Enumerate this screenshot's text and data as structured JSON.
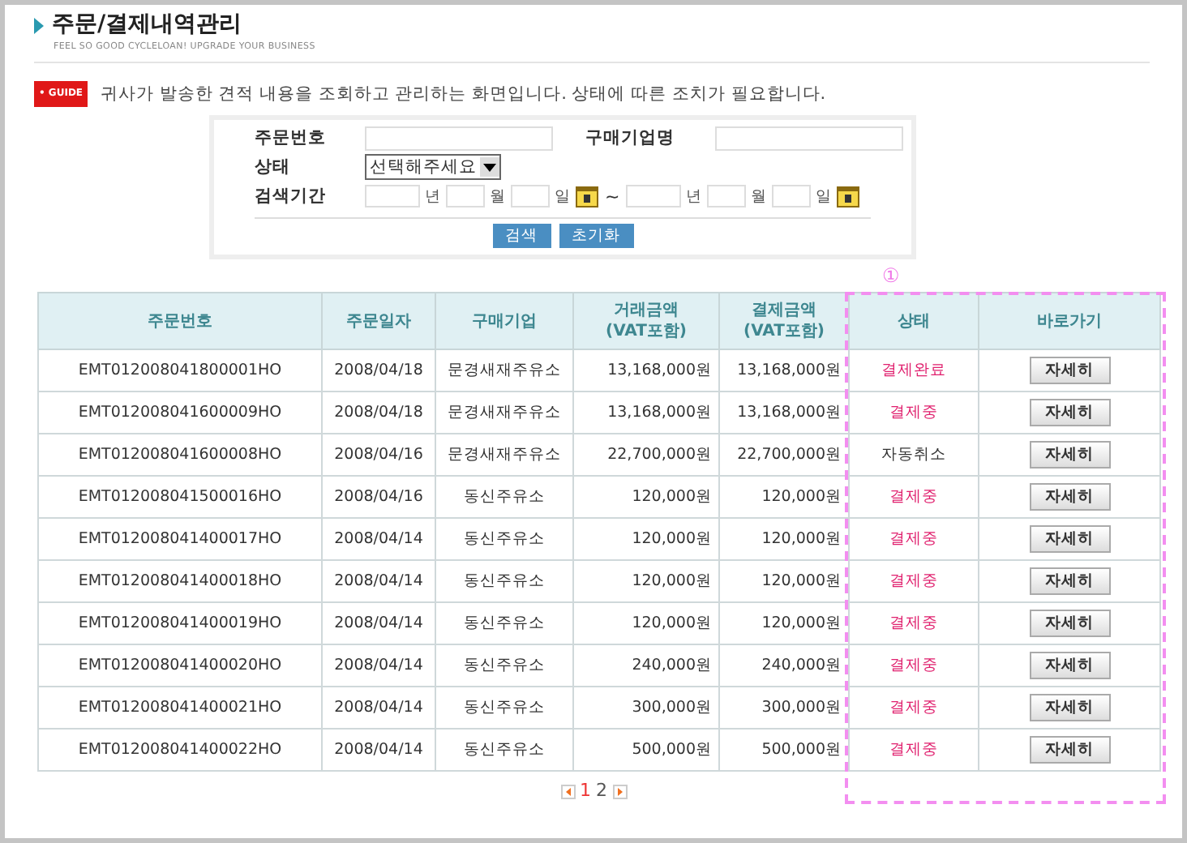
{
  "header": {
    "title": "주문/결제내역관리",
    "subtitle": "FEEL SO GOOD CYCLELOAN! UPGRADE YOUR BUSINESS"
  },
  "guide": {
    "badge": "• GUIDE",
    "text": "귀사가 발송한 견적 내용을 조회하고 관리하는 화면입니다. 상태에 따른 조치가 필요합니다."
  },
  "search": {
    "order_no_label": "주문번호",
    "buyer_label": "구매기업명",
    "status_label": "상태",
    "status_value": "선택해주세요",
    "period_label": "검색기간",
    "period_from_units": [
      "년",
      "월",
      "일"
    ],
    "period_sep": "~",
    "period_to_units": [
      "년",
      "월",
      "일"
    ],
    "buttons": [
      "검색",
      "초기화"
    ]
  },
  "annotation": {
    "marker": "①"
  },
  "table": {
    "columns": [
      "주문번호",
      "주문일자",
      "구매기업",
      "거래금액\n(VAT포함)",
      "결제금액\n(VAT포함)",
      "상태",
      "바로가기"
    ],
    "rows": [
      {
        "order_no": "EMT012008041800001HO",
        "date": "2008/04/18",
        "buyer": "문경새재주유소",
        "amount": "13,168,000원",
        "paid": "13,168,000원",
        "status": "결제완료",
        "color": "#e0206e",
        "action": "자세히"
      },
      {
        "order_no": "EMT012008041600009HO",
        "date": "2008/04/18",
        "buyer": "문경새재주유소",
        "amount": "13,168,000원",
        "paid": "13,168,000원",
        "status": "결제중",
        "color": "#e0206e",
        "action": "자세히"
      },
      {
        "order_no": "EMT012008041600008HO",
        "date": "2008/04/16",
        "buyer": "문경새재주유소",
        "amount": "22,700,000원",
        "paid": "22,700,000원",
        "status": "자동취소",
        "color": "#333333",
        "action": "자세히"
      },
      {
        "order_no": "EMT012008041500016HO",
        "date": "2008/04/16",
        "buyer": "동신주유소",
        "amount": "120,000원",
        "paid": "120,000원",
        "status": "결제중",
        "color": "#e0206e",
        "action": "자세히"
      },
      {
        "order_no": "EMT012008041400017HO",
        "date": "2008/04/14",
        "buyer": "동신주유소",
        "amount": "120,000원",
        "paid": "120,000원",
        "status": "결제중",
        "color": "#e0206e",
        "action": "자세히"
      },
      {
        "order_no": "EMT012008041400018HO",
        "date": "2008/04/14",
        "buyer": "동신주유소",
        "amount": "120,000원",
        "paid": "120,000원",
        "status": "결제중",
        "color": "#e0206e",
        "action": "자세히"
      },
      {
        "order_no": "EMT012008041400019HO",
        "date": "2008/04/14",
        "buyer": "동신주유소",
        "amount": "120,000원",
        "paid": "120,000원",
        "status": "결제중",
        "color": "#e0206e",
        "action": "자세히"
      },
      {
        "order_no": "EMT012008041400020HO",
        "date": "2008/04/14",
        "buyer": "동신주유소",
        "amount": "240,000원",
        "paid": "240,000원",
        "status": "결제중",
        "color": "#e0206e",
        "action": "자세히"
      },
      {
        "order_no": "EMT012008041400021HO",
        "date": "2008/04/14",
        "buyer": "동신주유소",
        "amount": "300,000원",
        "paid": "300,000원",
        "status": "결제중",
        "color": "#e0206e",
        "action": "자세히"
      },
      {
        "order_no": "EMT012008041400022HO",
        "date": "2008/04/14",
        "buyer": "동신주유소",
        "amount": "500,000원",
        "paid": "500,000원",
        "status": "결제중",
        "color": "#e0206e",
        "action": "자세히"
      }
    ]
  },
  "pagination": {
    "pages": [
      {
        "label": "1",
        "selected": true
      },
      {
        "label": "2",
        "selected": false
      }
    ]
  }
}
